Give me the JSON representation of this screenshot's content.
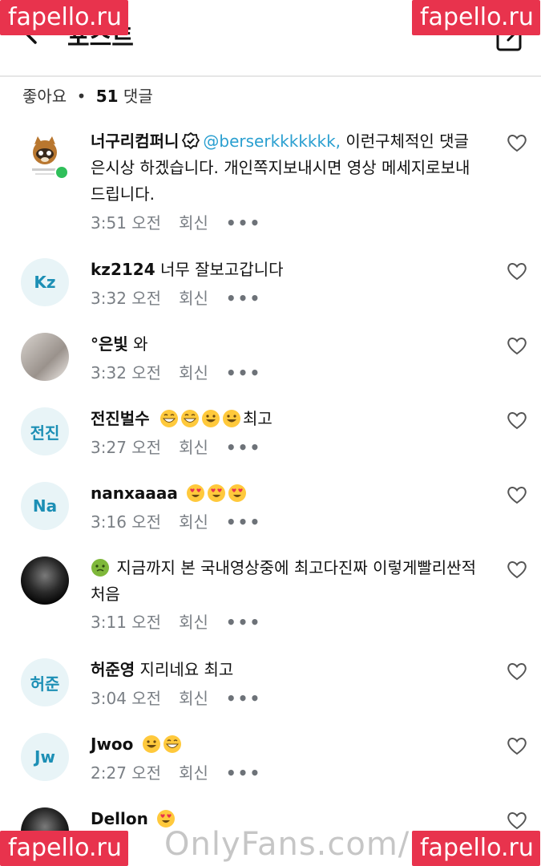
{
  "header": {
    "title": "포스트"
  },
  "summary": {
    "likes_label": "좋아요",
    "separator": "•",
    "comment_count": "51",
    "comments_label": "댓글"
  },
  "watermarks": {
    "site": "fapello.ru",
    "overlay": "OnlyFans.com/m"
  },
  "comments": [
    {
      "avatar": "",
      "user": "너구리컴퍼니",
      "verified": true,
      "mention": "@berserkkkkkkk,",
      "text": " 이런구체적인 댓글은시상 하겠습니다. 개인쪽지보내시면 영상 메세지로보내드립니다.",
      "time": "3:51 오전",
      "reply": "회신"
    },
    {
      "avatar": "Kz",
      "user": "kz2124",
      "text": " 너무 잘보고갑니다",
      "time": "3:32 오전",
      "reply": "회신"
    },
    {
      "avatar": "",
      "user": "°은빛",
      "text": " 와",
      "time": "3:32 오전",
      "reply": "회신"
    },
    {
      "avatar": "전진",
      "user": "전진벌수",
      "text": "최고",
      "time": "3:27 오전",
      "reply": "회신"
    },
    {
      "avatar": "Na",
      "user": "nanxaaaa",
      "text": "",
      "time": "3:16 오전",
      "reply": "회신"
    },
    {
      "avatar": "",
      "user": "",
      "text": " 지금까지 본 국내영상중에 최고다진짜 이렇게빨리싼적 처음",
      "time": "3:11 오전",
      "reply": "회신"
    },
    {
      "avatar": "허준",
      "user": "허준영",
      "text": " 지리네요 최고",
      "time": "3:04 오전",
      "reply": "회신"
    },
    {
      "avatar": "Jw",
      "user": "Jwoo",
      "text": "",
      "time": "2:27 오전",
      "reply": "회신"
    },
    {
      "avatar": "",
      "user": "Dellon",
      "text": "",
      "time": "",
      "reply": ""
    }
  ],
  "colors": {
    "accent": "#2a9fd0",
    "online": "#2fbf5a",
    "watermark": "#e8334d"
  },
  "icons": {
    "back": "back-arrow-icon",
    "compose": "compose-icon",
    "like": "heart-icon",
    "more": "more-icon",
    "verified": "verified-badge-icon"
  }
}
